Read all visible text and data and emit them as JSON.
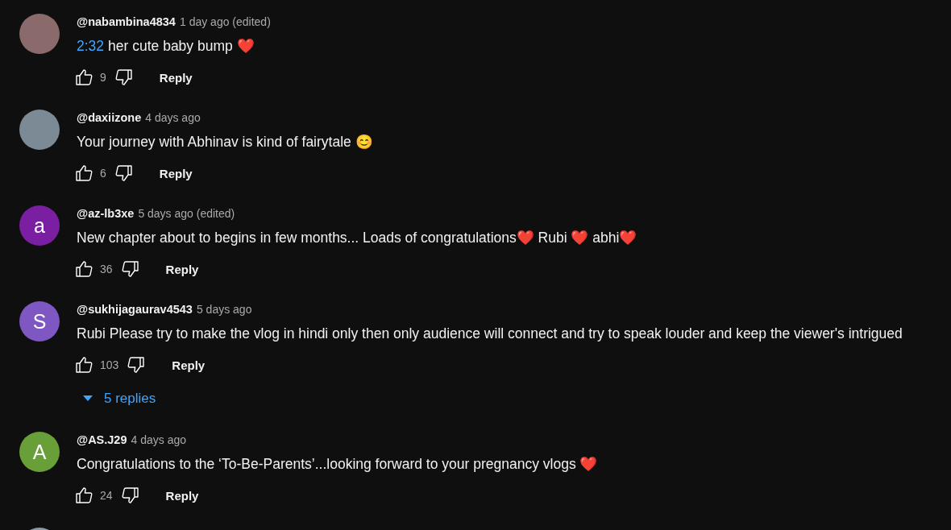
{
  "comments": [
    {
      "avatar": {
        "kind": "photo",
        "color": "#8a6a6a"
      },
      "username": "@nabambina4834",
      "meta": "1 day ago (edited)",
      "timestamp": "2:32",
      "text": "her cute baby bump ❤️",
      "likes": "9",
      "reply": "Reply"
    },
    {
      "avatar": {
        "kind": "photo",
        "color": "#7c8a96"
      },
      "username": "@daxiizone",
      "meta": "4 days ago",
      "text": "Your journey with Abhinav is kind of fairytale 😊",
      "likes": "6",
      "reply": "Reply"
    },
    {
      "avatar": {
        "kind": "letter",
        "letter": "a",
        "color": "#7b1fa2"
      },
      "username": "@az-lb3xe",
      "meta": "5 days ago (edited)",
      "text": "New chapter about to begins in few months... Loads of congratulations❤️  Rubi ❤️ abhi❤️",
      "likes": "36",
      "reply": "Reply"
    },
    {
      "avatar": {
        "kind": "letter",
        "letter": "S",
        "color": "#7e57c2"
      },
      "username": "@sukhijagaurav4543",
      "meta": "5 days ago",
      "text": "Rubi Please try to make the vlog in hindi only then only audience will connect and try to speak louder and keep the viewer's intrigued",
      "likes": "103",
      "reply": "Reply",
      "replies": "5 replies"
    },
    {
      "avatar": {
        "kind": "letter",
        "letter": "A",
        "color": "#689f38"
      },
      "username": "@AS.J29",
      "meta": "4 days ago",
      "text": "Congratulations to the ‘To-Be-Parents’...looking forward to your pregnancy vlogs  ❤️",
      "likes": "24",
      "reply": "Reply"
    },
    {
      "avatar": {
        "kind": "photo",
        "color": "#8d9aa6"
      }
    }
  ]
}
